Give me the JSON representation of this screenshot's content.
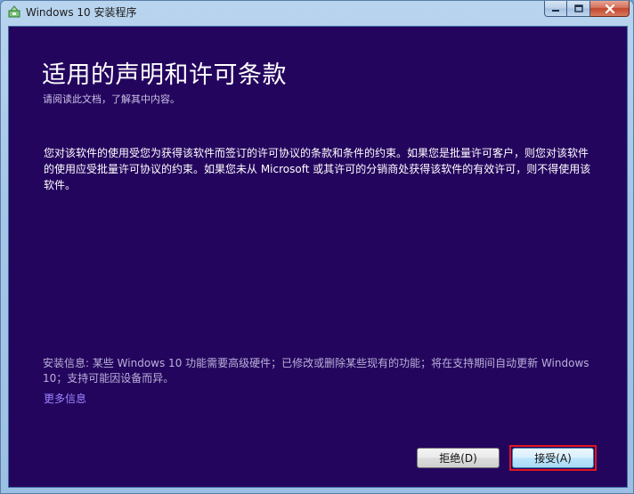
{
  "window": {
    "title": "Windows 10 安装程序",
    "icon": "setup-icon",
    "caption_buttons": [
      "minimize",
      "maximize",
      "close"
    ]
  },
  "page": {
    "title": "适用的声明和许可条款",
    "subtitle": "请阅读此文档，了解其中内容。",
    "license_text": "您对该软件的使用受您为获得该软件而签订的许可协议的条款和条件的约束。如果您是批量许可客户，则您对该软件的使用应受批量许可协议的约束。如果您未从 Microsoft 或其许可的分销商处获得该软件的有效许可，则不得使用该软件。",
    "install_info": "安装信息: 某些 Windows 10 功能需要高级硬件；已修改或删除某些现有的功能；将在支持期间自动更新 Windows 10；支持可能因设备而异。",
    "more_info_link": "更多信息"
  },
  "buttons": {
    "decline": "拒绝(D)",
    "accept": "接受(A)"
  },
  "colors": {
    "content_background": "#24055e",
    "link": "#9a86ff",
    "highlight_border": "#e0161e"
  }
}
